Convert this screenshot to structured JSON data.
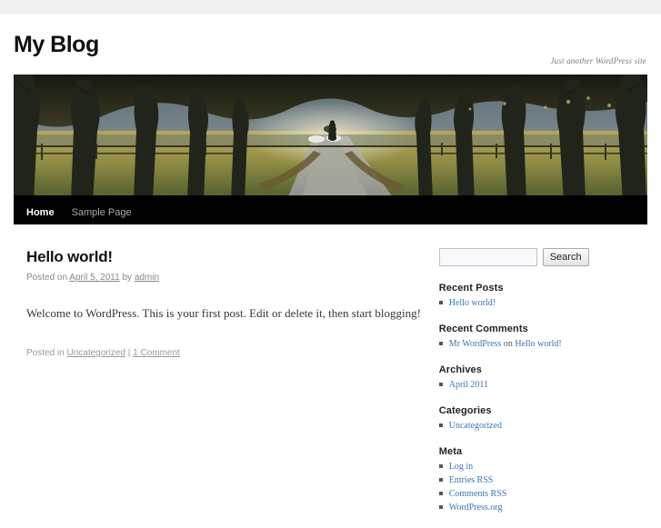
{
  "site": {
    "title": "My Blog",
    "description": "Just another WordPress site"
  },
  "header_image": {
    "alt": "Tree-lined path in a park with a person walking",
    "name": "header-photo"
  },
  "nav": {
    "items": [
      {
        "label": "Home",
        "current": true
      },
      {
        "label": "Sample Page",
        "current": false
      }
    ]
  },
  "post": {
    "title": "Hello world!",
    "meta_posted_on": "Posted on",
    "meta_date": "April 5, 2011",
    "meta_by": "by",
    "meta_author": "admin",
    "body": "Welcome to WordPress. This is your first post. Edit or delete it, then start blogging!",
    "footer_posted_in": "Posted in",
    "footer_category": "Uncategorized",
    "footer_separator": "|",
    "footer_comments": "1 Comment"
  },
  "sidebar": {
    "search": {
      "value": "",
      "placeholder": "",
      "button_label": "Search"
    },
    "widgets": [
      {
        "title": "Recent Posts",
        "items": [
          {
            "text": "Hello world!",
            "link": true
          }
        ]
      },
      {
        "title": "Recent Comments",
        "items": [
          {
            "text": "Mr WordPress",
            "link": true,
            "mid": " on ",
            "text2": "Hello world!"
          }
        ]
      },
      {
        "title": "Archives",
        "items": [
          {
            "text": "April 2011",
            "link": true
          }
        ]
      },
      {
        "title": "Categories",
        "items": [
          {
            "text": "Uncategorized",
            "link": true
          }
        ]
      },
      {
        "title": "Meta",
        "items": [
          {
            "text": "Log in",
            "link": true
          },
          {
            "text": "Entries RSS",
            "link": true
          },
          {
            "text": "Comments RSS",
            "link": true
          },
          {
            "text": "WordPress.org",
            "link": true
          }
        ]
      }
    ]
  },
  "colors": {
    "top_band": "#f1f1f1",
    "nav_background": "#000000",
    "link": "#3a74b3",
    "text": "#373737",
    "muted": "#888888"
  }
}
